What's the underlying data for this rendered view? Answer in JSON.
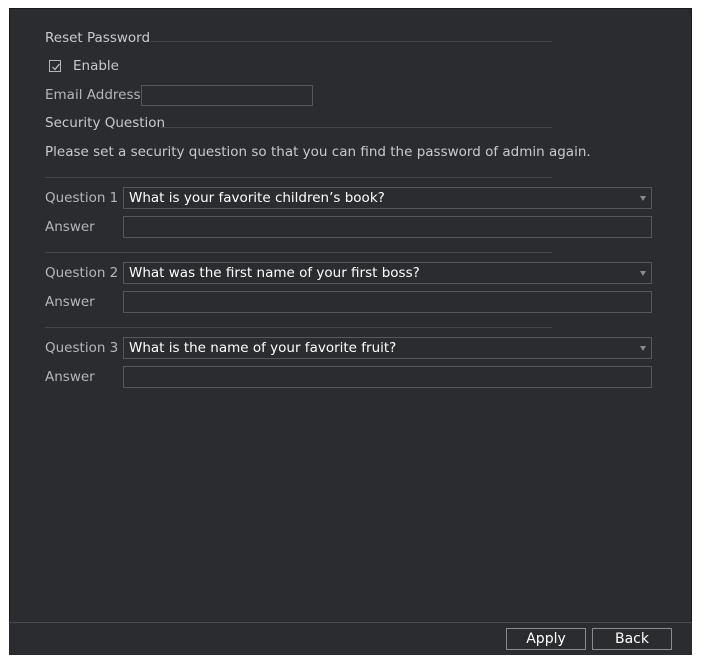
{
  "reset_password": {
    "title": "Reset Password",
    "enable_label": "Enable",
    "enable_checked": true,
    "email_label": "Email Address",
    "email_value": ""
  },
  "security_question": {
    "title": "Security Question",
    "description": "Please set a security question so that you can find the password of admin again.",
    "questions": [
      {
        "label": "Question 1",
        "selected": "What is your favorite children’s book?",
        "answer_label": "Answer",
        "answer_value": ""
      },
      {
        "label": "Question 2",
        "selected": "What was the first name of your first boss?",
        "answer_label": "Answer",
        "answer_value": ""
      },
      {
        "label": "Question 3",
        "selected": "What is the name of your favorite fruit?",
        "answer_label": "Answer",
        "answer_value": ""
      }
    ]
  },
  "footer": {
    "apply_label": "Apply",
    "back_label": "Back"
  },
  "colors": {
    "panel_bg": "#2b2c30",
    "text": "#c9cacd",
    "border": "#56575c"
  }
}
